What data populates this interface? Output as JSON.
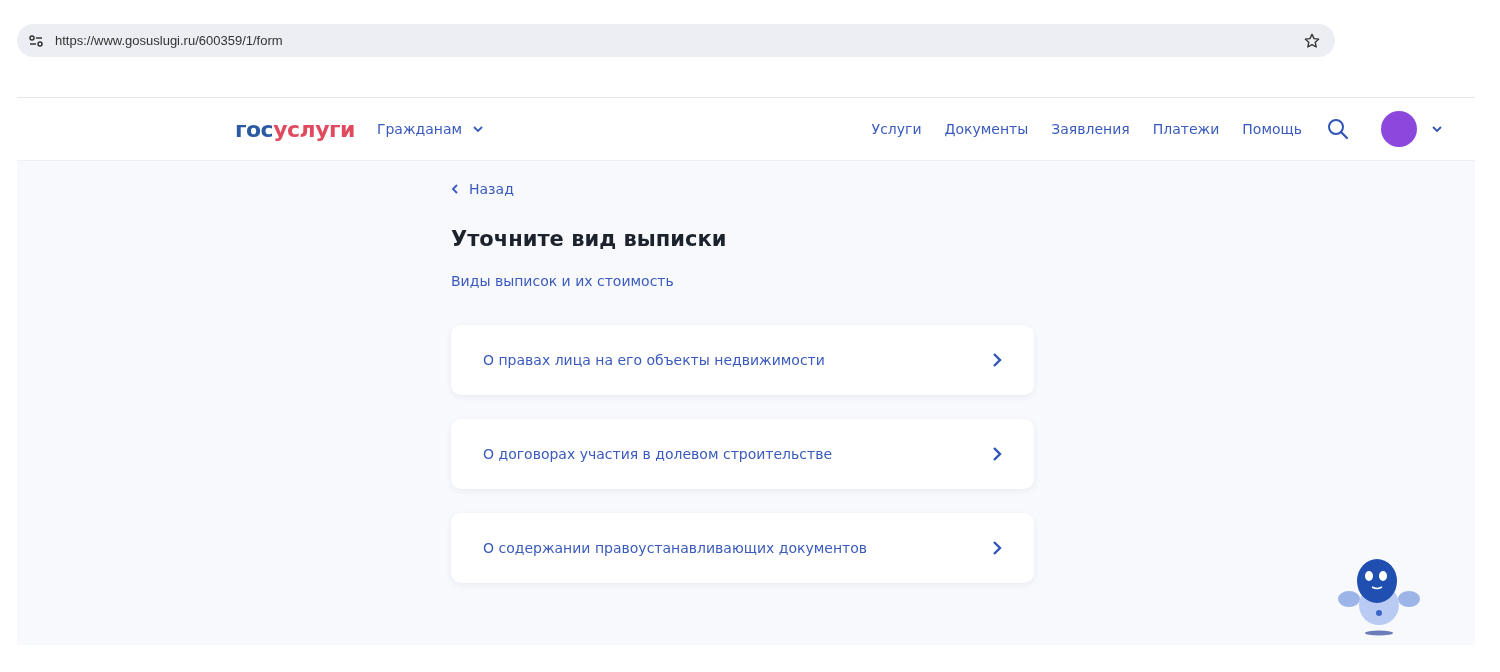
{
  "browser": {
    "url": "https://www.gosuslugi.ru/600359/1/form"
  },
  "header": {
    "logo": {
      "first": "гос",
      "second": "услуги"
    },
    "audience": "Гражданам",
    "nav": [
      "Услуги",
      "Документы",
      "Заявления",
      "Платежи",
      "Помощь"
    ]
  },
  "back": "Назад",
  "title": "Уточните вид выписки",
  "link": "Виды выписок и их стоимость",
  "options": [
    {
      "label": "О правах лица на его объекты недвижимости"
    },
    {
      "label": "О договорах участия в долевом строительстве"
    },
    {
      "label": "О содержании правоустанавливающих документов"
    }
  ]
}
